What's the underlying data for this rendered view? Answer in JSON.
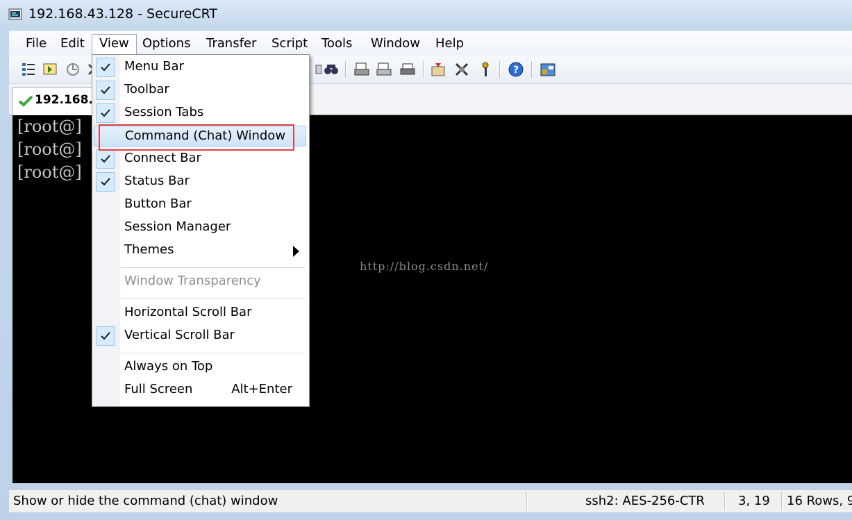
{
  "window": {
    "title": "192.168.43.128 - SecureCRT"
  },
  "menubar": {
    "items": [
      {
        "label": "File"
      },
      {
        "label": "Edit"
      },
      {
        "label": "View"
      },
      {
        "label": "Options"
      },
      {
        "label": "Transfer"
      },
      {
        "label": "Script"
      },
      {
        "label": "Tools"
      },
      {
        "label": "Window"
      },
      {
        "label": "Help"
      }
    ]
  },
  "session_tab": {
    "label": "192.168.4"
  },
  "terminal": {
    "lines": [
      "[root@]",
      "[root@]",
      "[root@]"
    ],
    "watermark": "http://blog.csdn.net/"
  },
  "view_menu": {
    "items": [
      {
        "label": "Menu Bar",
        "checked": true
      },
      {
        "label": "Toolbar",
        "checked": true
      },
      {
        "label": "Session Tabs",
        "checked": true
      },
      {
        "label": "Command (Chat) Window",
        "checked": false,
        "highlighted": true
      },
      {
        "label": "Connect Bar",
        "checked": true
      },
      {
        "label": "Status Bar",
        "checked": true
      },
      {
        "label": "Button Bar",
        "checked": false
      },
      {
        "label": "Session Manager",
        "checked": false
      },
      {
        "label": "Themes",
        "checked": false,
        "submenu": true
      },
      {
        "label": "Window Transparency",
        "disabled": true
      },
      {
        "label": "Horizontal Scroll Bar",
        "checked": false
      },
      {
        "label": "Vertical Scroll Bar",
        "checked": true
      },
      {
        "label": "Always on Top",
        "checked": false
      },
      {
        "label": "Full Screen",
        "checked": false,
        "accelerator": "Alt+Enter"
      }
    ]
  },
  "statusbar": {
    "message": "Show or hide the command (chat) window",
    "cipher": "ssh2: AES-256-CTR",
    "cursor": "3,  19",
    "rows": "16 Rows, 9"
  },
  "colors": {
    "highlight_border": "#e0444a",
    "menu_hover": "#cfe4f9",
    "terminal_bg": "#000000"
  }
}
